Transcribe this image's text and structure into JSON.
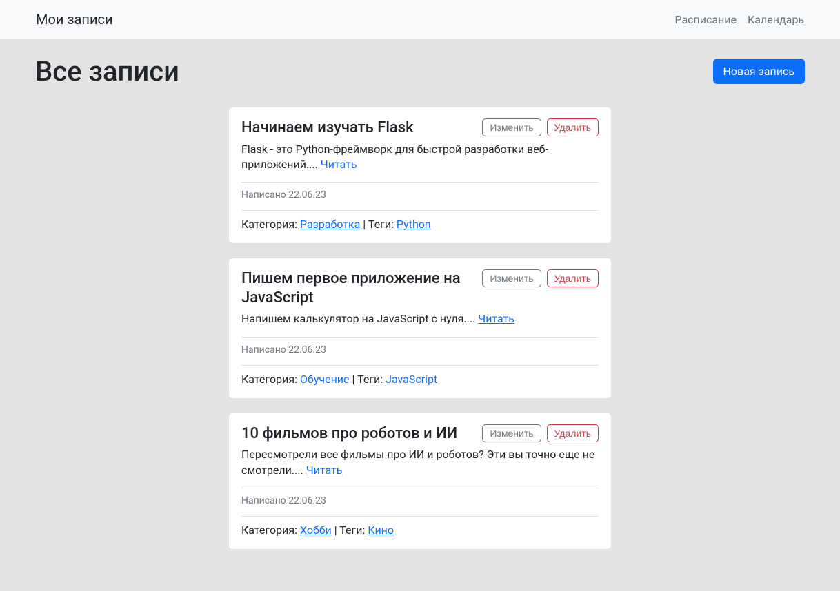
{
  "nav": {
    "brand": "Мои записи",
    "links": [
      "Расписание",
      "Календарь"
    ]
  },
  "header": {
    "title": "Все записи",
    "new_button": "Новая запись"
  },
  "buttons": {
    "edit": "Изменить",
    "delete": "Удалить",
    "read": "Читать"
  },
  "labels": {
    "written": "Написано",
    "category": "Категория:",
    "tags": "Теги:",
    "divider": " | "
  },
  "posts": [
    {
      "title": "Начинаем изучать Flask",
      "body": "Flask - это Python-фреймворк для быстрой разработки веб-приложений....",
      "date": "22.06.23",
      "category": "Разработка",
      "tag": "Python"
    },
    {
      "title": "Пишем первое приложение на JavaScript",
      "body": "Напишем калькулятор на JavaScript с нуля....",
      "date": "22.06.23",
      "category": "Обучение",
      "tag": "JavaScript"
    },
    {
      "title": "10 фильмов про роботов и ИИ",
      "body": "Пересмотрели все фильмы про ИИ и роботов? Эти вы точно еще не смотрели....",
      "date": "22.06.23",
      "category": "Хобби",
      "tag": "Кино"
    }
  ]
}
